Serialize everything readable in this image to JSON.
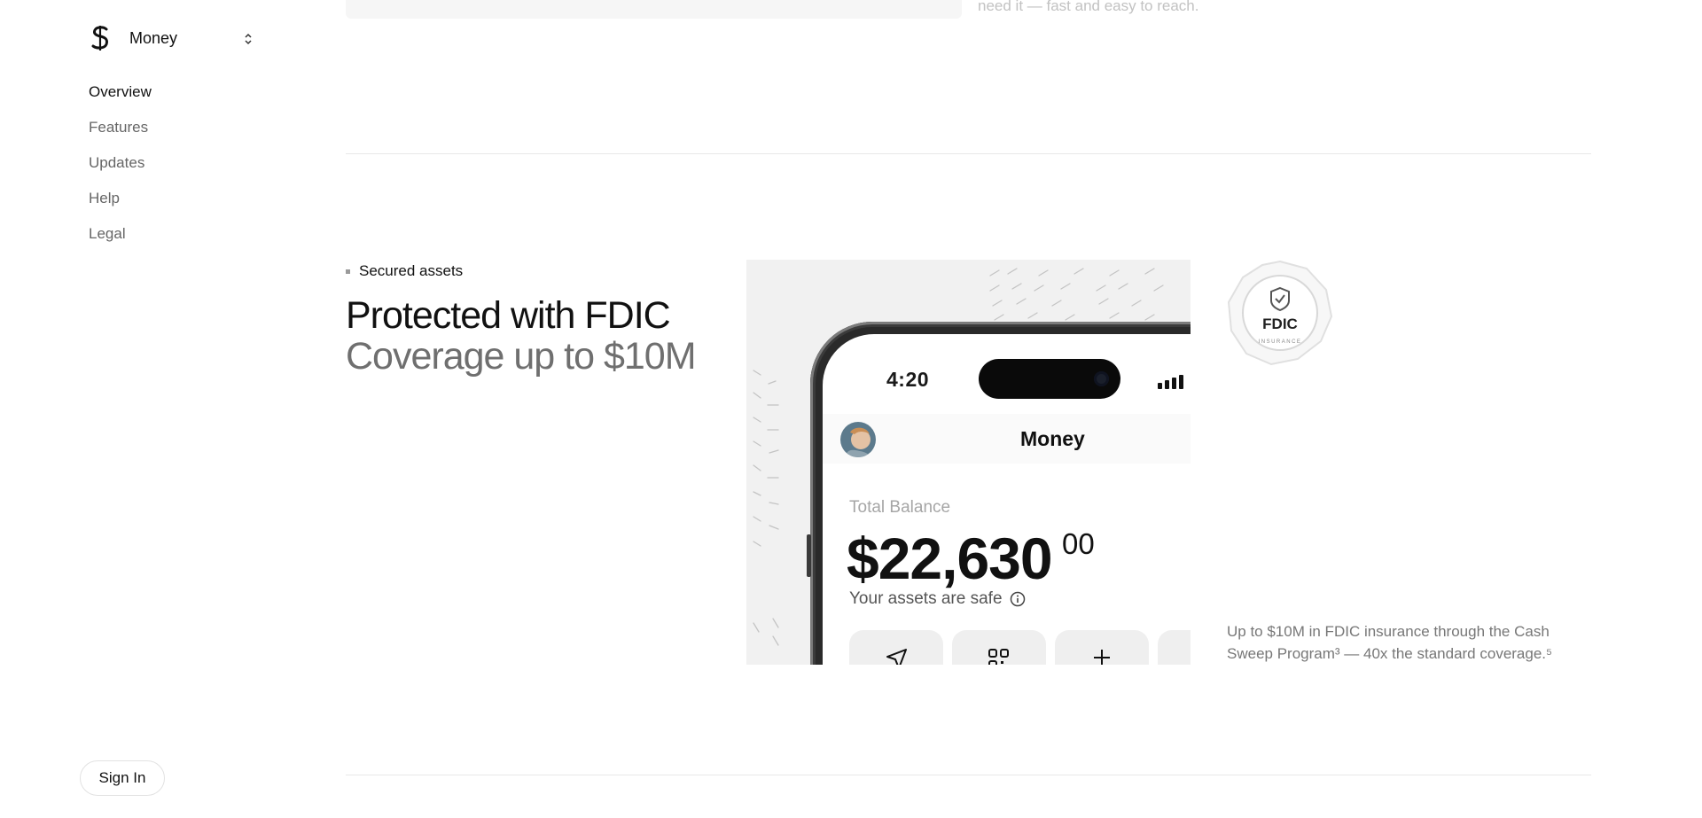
{
  "sidebar": {
    "app_name": "Money",
    "nav": [
      {
        "label": "Overview",
        "active": true
      },
      {
        "label": "Features",
        "active": false
      },
      {
        "label": "Updates",
        "active": false
      },
      {
        "label": "Help",
        "active": false
      },
      {
        "label": "Legal",
        "active": false
      }
    ],
    "sign_in_label": "Sign In"
  },
  "previous_section": {
    "text_fragment": "need it — fast and easy to reach."
  },
  "section": {
    "eyebrow": "Secured assets",
    "headline": "Protected with FDIC",
    "subheadline": "Coverage up to $10M",
    "description": "Up to $10M in FDIC insurance through the Cash Sweep Program³ — 40x the standard coverage.⁵",
    "badge": {
      "title": "FDIC",
      "subtitle": "INSURANCE"
    }
  },
  "phone": {
    "time": "4:20",
    "app_title": "Money",
    "balance_label": "Total Balance",
    "balance": "$22,630",
    "balance_cents": "00",
    "safe_text": "Your assets are safe",
    "actions": [
      "send-icon",
      "qr-code-icon",
      "plus-icon"
    ]
  },
  "colors": {
    "text_primary": "#111111",
    "text_secondary": "#6f6f6f",
    "muted": "#777777",
    "panel_bg": "#f1f1f1",
    "divider": "#e8e8e8"
  }
}
